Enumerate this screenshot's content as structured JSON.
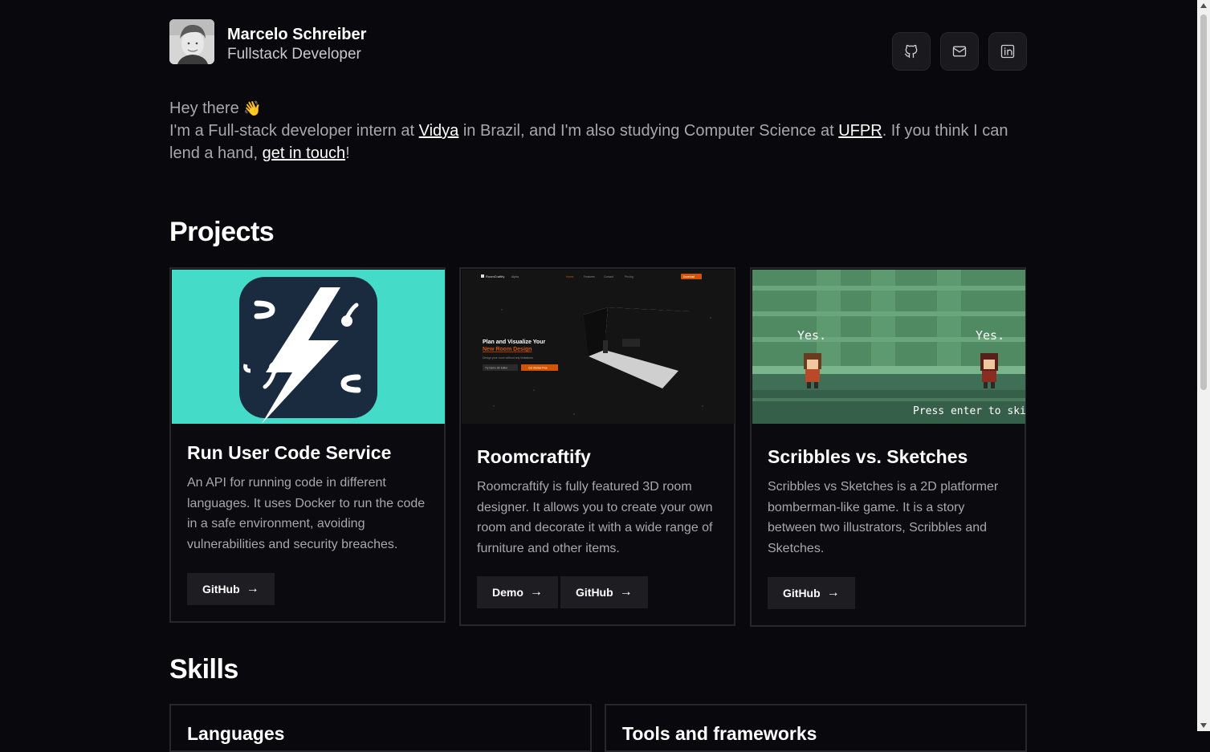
{
  "profile": {
    "name": "Marcelo Schreiber",
    "role": "Fullstack Developer"
  },
  "social": [
    {
      "icon": "github-icon"
    },
    {
      "icon": "mail-icon"
    },
    {
      "icon": "linkedin-icon",
      "text": "in"
    }
  ],
  "intro": {
    "greeting": "Hey there",
    "wave": "👋",
    "line_a": "I'm a Full-stack developer intern at ",
    "link_vidya": "Vidya",
    "line_b": " in Brazil, and I'm also studying Computer Science at ",
    "link_ufpr": "UFPR",
    "line_c": ". If you think I can lend a hand, ",
    "link_contact": "get in touch",
    "line_d": "!"
  },
  "projects": {
    "heading": "Projects",
    "items": [
      {
        "title": "Run User Code Service",
        "description": "An API for running code in different languages. It uses Docker to run the code in a safe environment, avoiding vulnerabilities and security breaches.",
        "buttons": [
          "GitHub"
        ]
      },
      {
        "title": "Roomcraftify",
        "description": "Roomcraftify is fully featured 3D room designer. It allows you to create your own room and decorate it with a wide range of furniture and other items.",
        "buttons": [
          "Demo",
          "GitHub"
        ],
        "thumb_text": {
          "brand": "RoomCraftify",
          "badge": "Alpha",
          "nav": [
            "Home",
            "Features",
            "Contact",
            "Pricing"
          ],
          "cta": "Download",
          "hero_a": "Plan and Visualize Your",
          "hero_b": "New Room Design",
          "hero_sub": "Design your room without any limitations",
          "btn_a": "Try Demo 3D Editor",
          "btn_b": "Get Started Free"
        }
      },
      {
        "title": "Scribbles vs. Sketches",
        "description": "Scribbles vs Sketches is a 2D platformer bomberman-like game. It is a story between two illustrators, Scribbles and Sketches.",
        "buttons": [
          "GitHub"
        ],
        "thumb_text": {
          "left_speech": "Yes.",
          "right_speech": "Yes.",
          "prompt": "Press enter to skip..."
        }
      }
    ]
  },
  "skills": {
    "heading": "Skills",
    "cards": [
      "Languages",
      "Tools and frameworks"
    ]
  },
  "colors": {
    "background": "#09080c",
    "card_border": "#27262b",
    "button_bg": "#1e1d22",
    "accent_orange": "#d35400",
    "thumb_teal": "#45dbc9",
    "thumb_navy": "#1b2b3f"
  }
}
